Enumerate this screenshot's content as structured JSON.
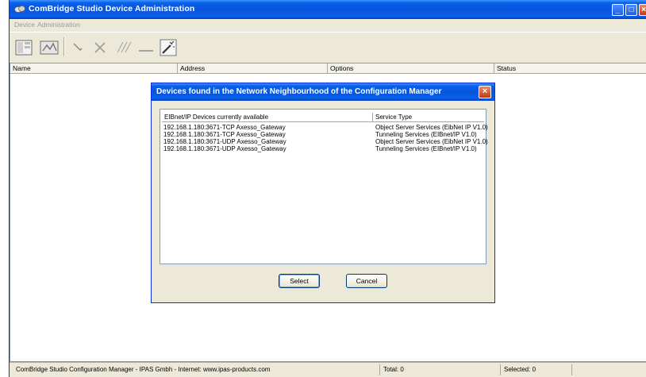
{
  "window": {
    "title": "ComBridge Studio Device Administration",
    "controls": [
      "minimize",
      "maximize",
      "close"
    ]
  },
  "menu": {
    "items": [
      "Device",
      "Administration"
    ]
  },
  "toolbar": {
    "icons": [
      "device-list-icon",
      "network-scan-icon",
      "wrench-icon",
      "delete-x-icon",
      "rename-icon",
      "line-icon",
      "wand-icon"
    ]
  },
  "list": {
    "columns": [
      "Name",
      "Address",
      "Options",
      "Status"
    ]
  },
  "dialog": {
    "title": "Devices found in the Network Neighbourhood of the Configuration Manager",
    "columns": [
      "EIBnet/IP Devices currently available",
      "Service Type"
    ],
    "rows": [
      [
        "192.168.1.180:3671-TCP Axesso_Gateway",
        "Object Server Services (EibNet IP V1.0)"
      ],
      [
        "192.168.1.180:3671-TCP Axesso_Gateway",
        "Tunneling Services (EIBnet/IP V1.0)"
      ],
      [
        "192.168.1.180:3671-UDP Axesso_Gateway",
        "Object Server Services (EibNet IP V1.0)"
      ],
      [
        "192.168.1.180:3671-UDP Axesso_Gateway",
        "Tunneling Services (EIBnet/IP V1.0)"
      ]
    ],
    "select_label": "Select",
    "cancel_label": "Cancel"
  },
  "status": {
    "text": "ComBridge Studio Configuration Manager - IPAS Gmbh - Internet: www.ipas-products.com",
    "total": "Total: 0",
    "selected": "Selected: 0"
  },
  "colors": {
    "title_blue": "#0855dd",
    "window_bg": "#ece9d8",
    "close_red": "#c23a12"
  }
}
